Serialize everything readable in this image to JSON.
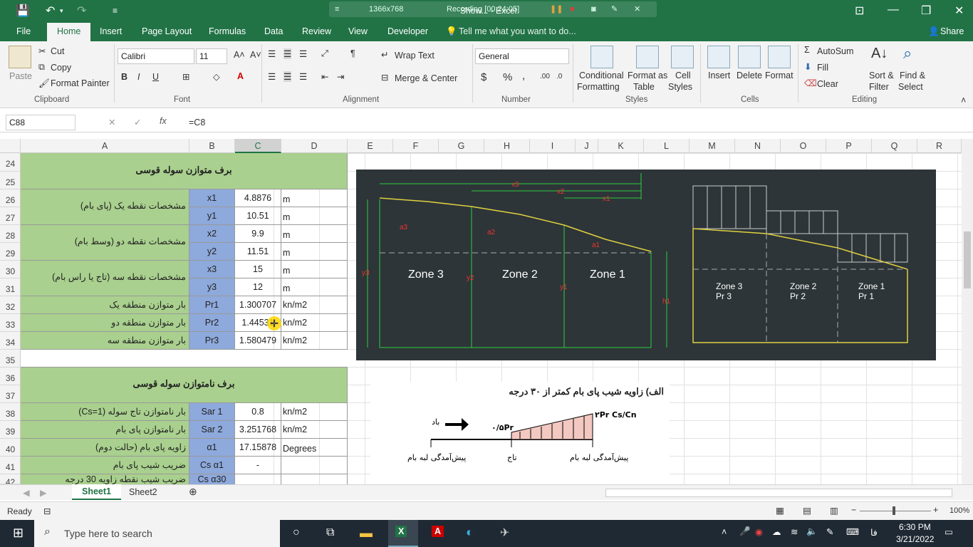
{
  "titlebar": {
    "title": "Show... - Excel",
    "recording_size": "1366x768",
    "recording_time": "Recording [00:24:05]"
  },
  "tabs": [
    "File",
    "Home",
    "Insert",
    "Page Layout",
    "Formulas",
    "Data",
    "Review",
    "View",
    "Developer"
  ],
  "tell_me": "Tell me what you want to do...",
  "share": "Share",
  "ribbon": {
    "clipboard": {
      "paste": "Paste",
      "cut": "Cut",
      "copy": "Copy",
      "format_painter": "Format Painter",
      "label": "Clipboard"
    },
    "font": {
      "name": "Calibri",
      "size": "11",
      "bold": "B",
      "italic": "I",
      "underline": "U",
      "label": "Font"
    },
    "alignment": {
      "wrap": "Wrap Text",
      "merge": "Merge & Center",
      "label": "Alignment"
    },
    "number": {
      "format": "General",
      "label": "Number",
      "currency": "$",
      "percent": "%",
      "comma": ","
    },
    "styles": {
      "conditional_1": "Conditional",
      "conditional_2": "Formatting",
      "format_table_1": "Format as",
      "format_table_2": "Table",
      "cell_styles_1": "Cell",
      "cell_styles_2": "Styles",
      "label": "Styles"
    },
    "cells": {
      "insert": "Insert",
      "delete": "Delete",
      "format": "Format",
      "label": "Cells"
    },
    "editing": {
      "autosum": "AutoSum",
      "fill": "Fill",
      "clear": "Clear",
      "sort_1": "Sort &",
      "sort_2": "Filter",
      "find_1": "Find &",
      "find_2": "Select",
      "label": "Editing"
    }
  },
  "formula_bar": {
    "name_box": "C88",
    "fx": "fx",
    "formula": "=C8"
  },
  "columns": [
    "A",
    "B",
    "C",
    "D",
    "E",
    "F",
    "G",
    "H",
    "I",
    "J",
    "K",
    "L",
    "M",
    "N",
    "O",
    "P",
    "Q",
    "R"
  ],
  "rows": [
    "24",
    "25",
    "26",
    "27",
    "28",
    "29",
    "30",
    "31",
    "32",
    "33",
    "34",
    "35",
    "36",
    "37",
    "38",
    "39",
    "40",
    "41",
    "42"
  ],
  "sheet": {
    "header1": "برف متوازن سوله قوسی",
    "p1": "مشخصات نقطه یک (پای بام)",
    "p2": "مشخصات نقطه دو (وسط بام)",
    "p3": "مشخصات نقطه سه (تاج یا راس بام)",
    "pr1_label": "بار متوازن منطقه یک",
    "pr2_label": "بار متوازن منطقه دو",
    "pr3_label": "بار متوازن منطقه سه",
    "header2": "برف نامتوازن سوله قوسی",
    "sar1_label": "بار نامتوازن تاج سوله (Cs=1)",
    "sar2_label": "بار نامتوازن پای بام",
    "a1_label": "زاویه پای بام (حالت دوم)",
    "cs_label": "ضریب شیب پای بام",
    "row42_label": "ضریب شیب نقطه زاویه 30 درجه",
    "vars": [
      {
        "b": "x1",
        "c": "4.8876",
        "d": "m"
      },
      {
        "b": "y1",
        "c": "10.51",
        "d": "m"
      },
      {
        "b": "x2",
        "c": "9.9",
        "d": "m"
      },
      {
        "b": "y2",
        "c": "11.51",
        "d": "m"
      },
      {
        "b": "x3",
        "c": "15",
        "d": "m"
      },
      {
        "b": "y3",
        "c": "12",
        "d": "m"
      },
      {
        "b": "Pr1",
        "c": "1.300707",
        "d": "kn/m2"
      },
      {
        "b": "Pr2",
        "c": "1.44531",
        "d": "kn/m2"
      },
      {
        "b": "Pr3",
        "c": "1.580479",
        "d": "kn/m2"
      }
    ],
    "vars2": [
      {
        "b": "Sar 1",
        "c": "0.8",
        "d": "kn/m2"
      },
      {
        "b": "Sar 2",
        "c": "3.251768",
        "d": "kn/m2"
      },
      {
        "b": "α1",
        "c": "17.15878",
        "d": "Degrees"
      },
      {
        "b": "Cs α1",
        "c": "-",
        "d": ""
      },
      {
        "b": "Cs α30",
        "c": "",
        "d": ""
      }
    ]
  },
  "diagram1": {
    "x1": "x1",
    "x2": "x2",
    "x3": "x3",
    "y1": "y1",
    "y2": "y2",
    "y3": "y3",
    "a1": "a1",
    "a2": "a2",
    "a3": "a3",
    "h1": "h1",
    "z3": "Zone 3",
    "z2": "Zone 2",
    "z1": "Zone 1"
  },
  "diagram2": {
    "z3": "Zone 3",
    "pr3": "Pr 3",
    "z2": "Zone 2",
    "pr2": "Pr 2",
    "z1": "Zone 1",
    "pr1": "Pr 1"
  },
  "diagram3": {
    "title": "الف)  زاویه شیب پای بام کمتر از ۳۰ درجه",
    "wind": "باد",
    "half": "۰/۵Pr",
    "top": "۲Pr Cs/Cn",
    "eave1": "پیش‌آمدگی لبه بام",
    "crown": "تاج",
    "eave2": "پیش‌آمدگی لبه بام"
  },
  "sheets": [
    "Sheet1",
    "Sheet2"
  ],
  "status": {
    "ready": "Ready",
    "zoom": "100%"
  },
  "taskbar": {
    "search": "Type here to search",
    "time": "6:30 PM",
    "date": "3/21/2022",
    "lang": "فا"
  }
}
